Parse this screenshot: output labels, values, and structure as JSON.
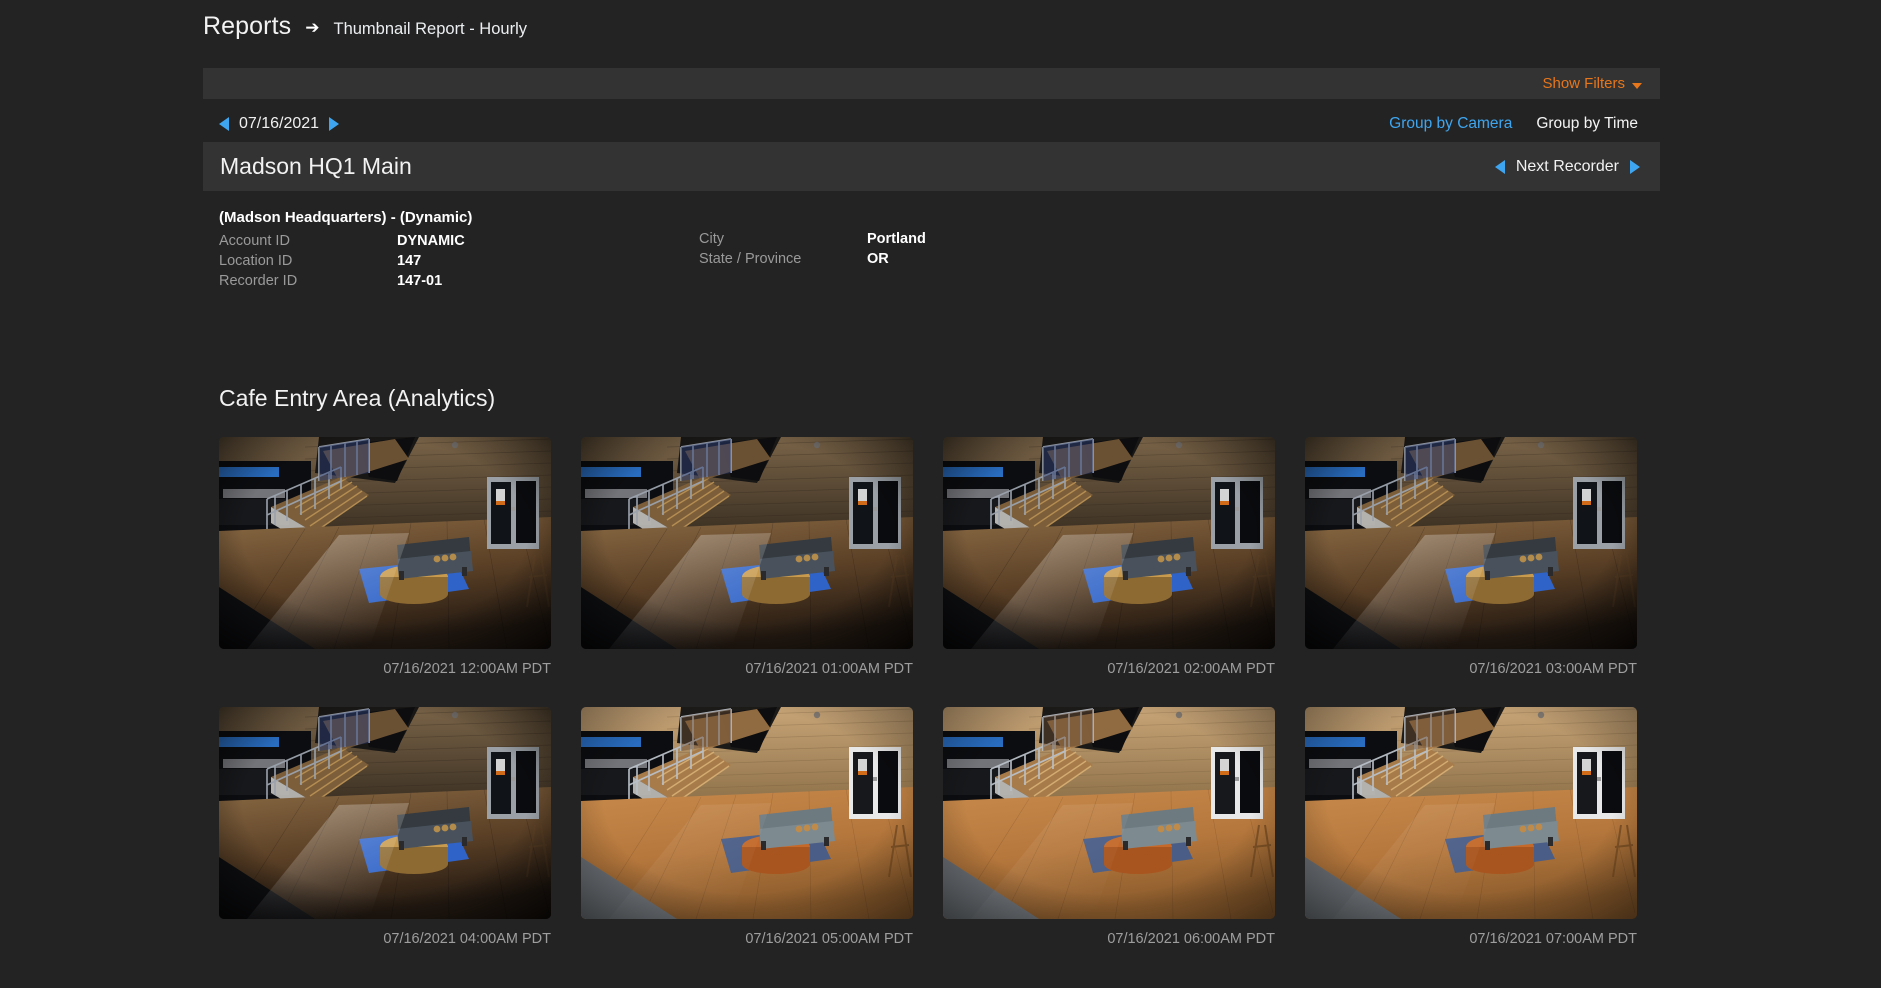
{
  "breadcrumb": {
    "root": "Reports",
    "arrow_icon": "arrow-right-icon",
    "leaf": "Thumbnail Report - Hourly"
  },
  "filter_bar": {
    "show_filters_label": "Show Filters",
    "caret_icon": "caret-down-icon",
    "accent_color": "#e8761a"
  },
  "date_nav": {
    "prev_icon": "triangle-left-icon",
    "date": "07/16/2021",
    "next_icon": "triangle-right-icon"
  },
  "group_links": {
    "by_camera": "Group by Camera",
    "by_time": "Group by Time",
    "link_color": "#3ea6f0"
  },
  "recorder_bar": {
    "title": "Madson HQ1 Main",
    "prev_icon": "triangle-left-icon",
    "next_recorder_label": "Next Recorder",
    "next_icon": "triangle-right-icon"
  },
  "meta": {
    "heading": "(Madson Headquarters) - (Dynamic)",
    "left": [
      {
        "label": "Account ID",
        "value": "DYNAMIC"
      },
      {
        "label": "Location ID",
        "value": "147"
      },
      {
        "label": "Recorder ID",
        "value": "147-01"
      }
    ],
    "right": [
      {
        "label": "City",
        "value": "Portland"
      },
      {
        "label": "State / Province",
        "value": "OR"
      }
    ]
  },
  "camera": {
    "title": "Cafe Entry Area (Analytics)",
    "thumbnails": [
      {
        "timestamp": "07/16/2021 12:00AM PDT",
        "scene": "night"
      },
      {
        "timestamp": "07/16/2021 01:00AM PDT",
        "scene": "night"
      },
      {
        "timestamp": "07/16/2021 02:00AM PDT",
        "scene": "night"
      },
      {
        "timestamp": "07/16/2021 03:00AM PDT",
        "scene": "night"
      },
      {
        "timestamp": "07/16/2021 04:00AM PDT",
        "scene": "night"
      },
      {
        "timestamp": "07/16/2021 05:00AM PDT",
        "scene": "day"
      },
      {
        "timestamp": "07/16/2021 06:00AM PDT",
        "scene": "day"
      },
      {
        "timestamp": "07/16/2021 07:00AM PDT",
        "scene": "day"
      }
    ]
  }
}
